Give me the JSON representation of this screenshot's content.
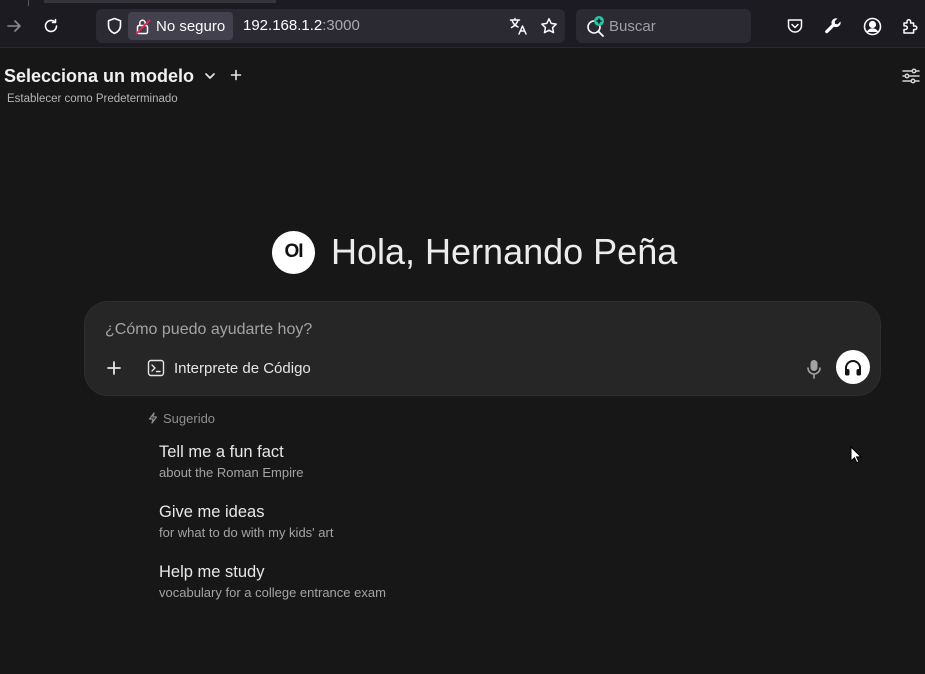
{
  "browser": {
    "security_label": "No seguro",
    "url_host": "192.168.1.2",
    "url_port": ":3000",
    "search_placeholder": "Buscar"
  },
  "header": {
    "model_selector_label": "Selecciona un modelo",
    "set_default_label": "Establecer como Predeterminado"
  },
  "greeting": {
    "logo_text": "OI",
    "text": "Hola, Hernando Peña"
  },
  "chat": {
    "placeholder": "¿Cómo puedo ayudarte hoy?",
    "code_interpreter_label": "Interprete de Código"
  },
  "suggestions": {
    "header": "Sugerido",
    "items": [
      {
        "title": "Tell me a fun fact",
        "subtitle": "about the Roman Empire"
      },
      {
        "title": "Give me ideas",
        "subtitle": "for what to do with my kids' art"
      },
      {
        "title": "Help me study",
        "subtitle": "vocabulary for a college entrance exam"
      }
    ]
  },
  "colors": {
    "background": "#171717",
    "input_background": "#262626",
    "browser_bar": "#1c1b22"
  }
}
